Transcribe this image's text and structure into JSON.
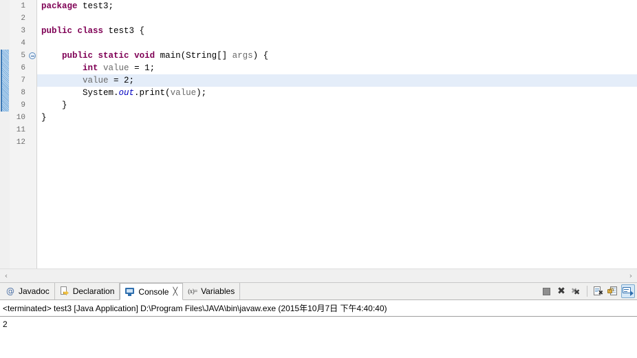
{
  "editor": {
    "name": "java-source-editor",
    "highlighted_line": 7,
    "fold_marker_line": 5,
    "annotation_range": [
      5,
      9
    ],
    "line_numbers": [
      "1",
      "2",
      "3",
      "4",
      "5",
      "6",
      "7",
      "8",
      "9",
      "10",
      "11",
      "12"
    ],
    "lines": [
      {
        "n": "1",
        "tokens": [
          {
            "t": "package",
            "c": "kw"
          },
          {
            "t": " test3;",
            "c": "plain"
          }
        ]
      },
      {
        "n": "2",
        "tokens": []
      },
      {
        "n": "3",
        "tokens": [
          {
            "t": "public",
            "c": "kw"
          },
          {
            "t": " ",
            "c": "plain"
          },
          {
            "t": "class",
            "c": "kw"
          },
          {
            "t": " test3 {",
            "c": "plain"
          }
        ]
      },
      {
        "n": "4",
        "tokens": []
      },
      {
        "n": "5",
        "tokens": [
          {
            "t": "    ",
            "c": "plain"
          },
          {
            "t": "public",
            "c": "kw"
          },
          {
            "t": " ",
            "c": "plain"
          },
          {
            "t": "static",
            "c": "kw"
          },
          {
            "t": " ",
            "c": "plain"
          },
          {
            "t": "void",
            "c": "kw"
          },
          {
            "t": " main(String[] ",
            "c": "plain"
          },
          {
            "t": "args",
            "c": "param"
          },
          {
            "t": ") {",
            "c": "plain"
          }
        ]
      },
      {
        "n": "6",
        "tokens": [
          {
            "t": "        ",
            "c": "plain"
          },
          {
            "t": "int",
            "c": "kw"
          },
          {
            "t": " ",
            "c": "plain"
          },
          {
            "t": "value",
            "c": "local"
          },
          {
            "t": " = 1;",
            "c": "plain"
          }
        ]
      },
      {
        "n": "7",
        "tokens": [
          {
            "t": "        ",
            "c": "plain"
          },
          {
            "t": "value",
            "c": "local"
          },
          {
            "t": " = 2;",
            "c": "plain"
          }
        ]
      },
      {
        "n": "8",
        "tokens": [
          {
            "t": "        System.",
            "c": "plain"
          },
          {
            "t": "out",
            "c": "field"
          },
          {
            "t": ".print(",
            "c": "plain"
          },
          {
            "t": "value",
            "c": "local"
          },
          {
            "t": ");",
            "c": "plain"
          }
        ]
      },
      {
        "n": "9",
        "tokens": [
          {
            "t": "    }",
            "c": "plain"
          }
        ]
      },
      {
        "n": "10",
        "tokens": [
          {
            "t": "}",
            "c": "plain"
          }
        ]
      },
      {
        "n": "11",
        "tokens": []
      },
      {
        "n": "12",
        "tokens": []
      }
    ],
    "scrollbar": {
      "left_arrow": "‹",
      "right_arrow": "›"
    }
  },
  "bottom_panel": {
    "tabs": [
      {
        "label": "Javadoc",
        "icon": "javadoc-icon",
        "active": false,
        "closable": false
      },
      {
        "label": "Declaration",
        "icon": "declaration-icon",
        "active": false,
        "closable": false
      },
      {
        "label": "Console",
        "icon": "console-icon",
        "active": true,
        "closable": true,
        "close_glyph": "╳"
      },
      {
        "label": "Variables",
        "icon": "variables-icon",
        "active": false,
        "closable": false
      }
    ],
    "toolbar": [
      {
        "name": "terminate-button",
        "icon": "terminate-icon",
        "pressed": false
      },
      {
        "name": "remove-launch-button",
        "icon": "remove-x-icon",
        "pressed": false
      },
      {
        "name": "remove-all-terminated-button",
        "icon": "remove-all-x-icon",
        "pressed": false
      },
      {
        "name": "clear-console-button",
        "icon": "clear-console-icon",
        "pressed": false
      },
      {
        "name": "scroll-lock-button",
        "icon": "scroll-lock-icon",
        "pressed": false
      },
      {
        "name": "display-selected-console-button",
        "icon": "display-console-icon",
        "pressed": true
      }
    ],
    "console": {
      "header": "<terminated> test3 [Java Application] D:\\Program Files\\JAVA\\bin\\javaw.exe (2015年10月7日 下午4:40:40)",
      "output": "2"
    }
  },
  "colors": {
    "keyword": "#7f0055",
    "static_field": "#0000c0",
    "local_var": "#6a6a6a",
    "line_highlight": "#e4edf9",
    "gutter_bg": "#f3f3f3",
    "annotation_bar": "#3c78b4",
    "active_tool_bg": "#d6e8f7"
  }
}
